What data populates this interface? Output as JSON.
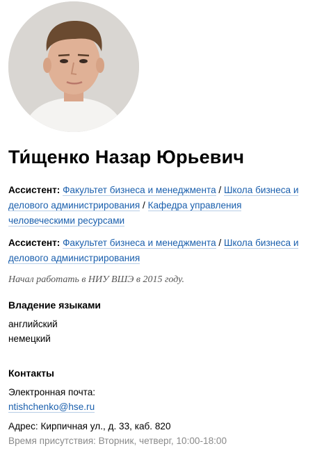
{
  "person": {
    "name": "Ти́щенко Назар Юрьевич"
  },
  "positions": [
    {
      "title": "Ассистент:",
      "links": [
        "Факультет бизнеса и менеджмента",
        "Школа бизнеса и делового администрирования",
        "Кафедра управления человеческими ресурсами"
      ]
    },
    {
      "title": "Ассистент:",
      "links": [
        "Факультет бизнеса и менеджмента",
        "Школа бизнеса и делового администрирования"
      ]
    }
  ],
  "separator": " / ",
  "started_note": "Начал работать в НИУ ВШЭ в 2015 году.",
  "languages": {
    "title": "Владение языками",
    "items": [
      "английский",
      "немецкий"
    ]
  },
  "contacts": {
    "title": "Контакты",
    "email_label": "Электронная почта:",
    "email": "ntishchenko@hse.ru",
    "address": "Адрес: Кирпичная ул., д. 33, каб. 820",
    "hours": "Время присутствия: Вторник, четверг, 10:00-18:00"
  },
  "colors": {
    "link": "#1a5fad",
    "muted": "#8a8a8a"
  }
}
